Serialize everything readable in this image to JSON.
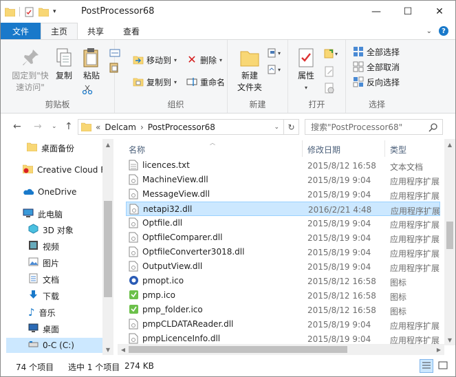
{
  "window": {
    "title": "PostProcessor68",
    "controls": {
      "minimize": "—",
      "maximize": "☐",
      "close": "✕"
    }
  },
  "ribbon_tabs": [
    {
      "label": "文件"
    },
    {
      "label": "主页"
    },
    {
      "label": "共享"
    },
    {
      "label": "查看"
    }
  ],
  "ribbon": {
    "clipboard": {
      "label": "剪贴板",
      "pin_label_1": "固定到\"快",
      "pin_label_2": "速访问\"",
      "copy": "复制",
      "paste": "粘贴"
    },
    "organize": {
      "label": "组织",
      "move_to": "移动到",
      "copy_to": "复制到",
      "delete": "删除",
      "rename": "重命名"
    },
    "new": {
      "label": "新建",
      "new_folder_1": "新建",
      "new_folder_2": "文件夹"
    },
    "open": {
      "label": "打开",
      "properties": "属性"
    },
    "select": {
      "label": "选择",
      "select_all": "全部选择",
      "select_none": "全部取消",
      "invert": "反向选择"
    }
  },
  "address": {
    "prefix": "«",
    "crumbs": [
      "Delcam",
      "PostProcessor68"
    ],
    "crumb_sep": "›",
    "search_placeholder": "搜索\"PostProcessor68\""
  },
  "nav_items": [
    {
      "label": "桌面备份",
      "icon": "folder-icon"
    },
    {
      "label": "Creative Cloud Files",
      "icon": "creative-cloud-icon"
    },
    {
      "label": "OneDrive",
      "icon": "onedrive-icon"
    },
    {
      "label": "此电脑",
      "icon": "computer-icon"
    },
    {
      "label": "3D 对象",
      "icon": "3d-objects-icon"
    },
    {
      "label": "视频",
      "icon": "video-icon"
    },
    {
      "label": "图片",
      "icon": "pictures-icon"
    },
    {
      "label": "文档",
      "icon": "documents-icon"
    },
    {
      "label": "下载",
      "icon": "download-icon"
    },
    {
      "label": "音乐",
      "icon": "music-icon"
    },
    {
      "label": "桌面",
      "icon": "desktop-icon"
    },
    {
      "label": "0-C (C:)",
      "icon": "drive-icon"
    }
  ],
  "columns": {
    "name": "名称",
    "date": "修改日期",
    "type": "类型"
  },
  "files": [
    {
      "name": "licences.txt",
      "date": "2015/8/12 16:58",
      "type": "文本文档",
      "icon": "text-file-icon"
    },
    {
      "name": "MachineView.dll",
      "date": "2015/8/19 9:04",
      "type": "应用程序扩展",
      "icon": "dll-file-icon"
    },
    {
      "name": "MessageView.dll",
      "date": "2015/8/19 9:04",
      "type": "应用程序扩展",
      "icon": "dll-file-icon"
    },
    {
      "name": "netapi32.dll",
      "date": "2016/2/21 4:48",
      "type": "应用程序扩展",
      "icon": "dll-file-icon"
    },
    {
      "name": "Optfile.dll",
      "date": "2015/8/19 9:04",
      "type": "应用程序扩展",
      "icon": "dll-file-icon"
    },
    {
      "name": "OptfileComparer.dll",
      "date": "2015/8/19 9:04",
      "type": "应用程序扩展",
      "icon": "dll-file-icon"
    },
    {
      "name": "OptfileConverter3018.dll",
      "date": "2015/8/19 9:04",
      "type": "应用程序扩展",
      "icon": "dll-file-icon"
    },
    {
      "name": "OutputView.dll",
      "date": "2015/8/19 9:04",
      "type": "应用程序扩展",
      "icon": "dll-file-icon"
    },
    {
      "name": "pmopt.ico",
      "date": "2015/8/12 16:58",
      "type": "图标",
      "icon": "pmopt-ico-icon"
    },
    {
      "name": "pmp.ico",
      "date": "2015/8/12 16:58",
      "type": "图标",
      "icon": "pmp-ico-icon"
    },
    {
      "name": "pmp_folder.ico",
      "date": "2015/8/12 16:58",
      "type": "图标",
      "icon": "pmp-ico-icon"
    },
    {
      "name": "pmpCLDATAReader.dll",
      "date": "2015/8/19 9:04",
      "type": "应用程序扩展",
      "icon": "dll-file-icon"
    },
    {
      "name": "pmpLicenceInfo.dll",
      "date": "2015/8/19 9:04",
      "type": "应用程序扩展",
      "icon": "dll-file-icon"
    }
  ],
  "status": {
    "count": "74 个项目",
    "selected": "选中 1 个项目",
    "size": "274 KB"
  },
  "colors": {
    "accent": "#1979ca",
    "selection": "#cce8ff",
    "selection_border": "#99d1ff",
    "folder": "#f8d775"
  }
}
